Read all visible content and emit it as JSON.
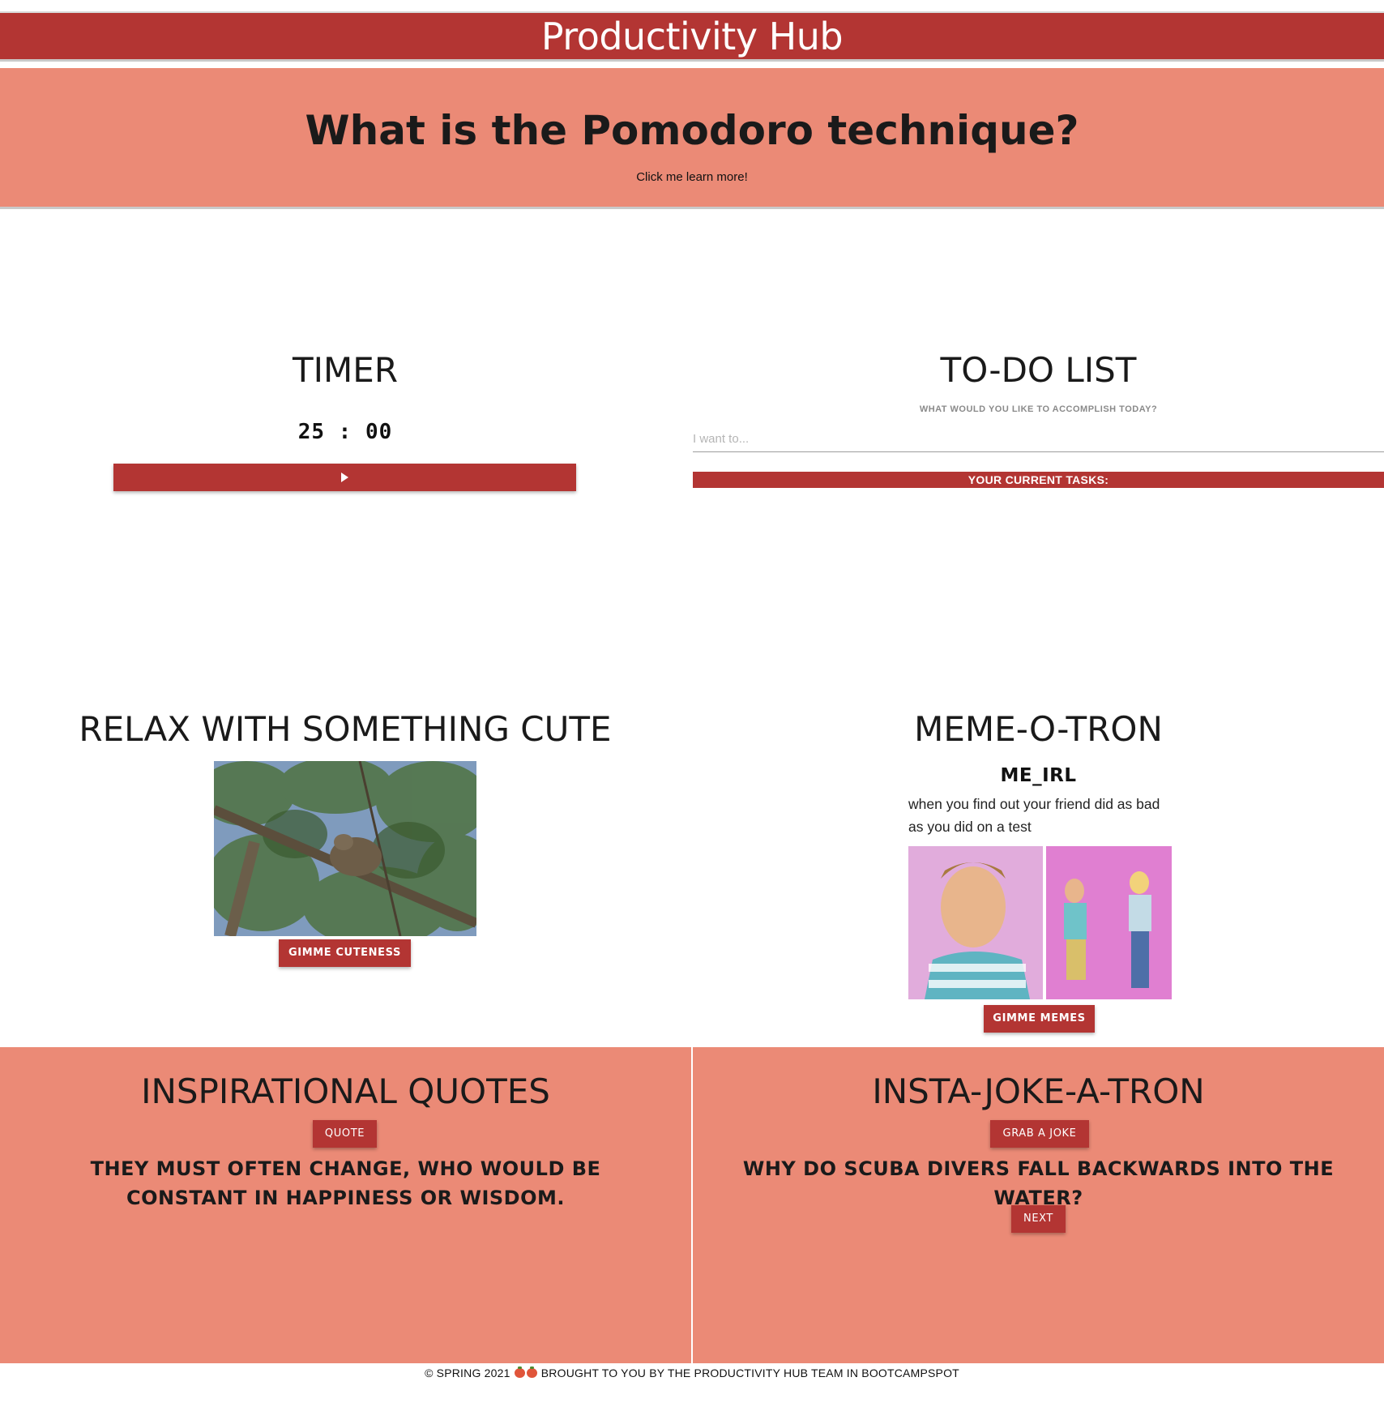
{
  "header": {
    "brand": "Productivity Hub"
  },
  "hero": {
    "title": "What is the Pomodoro technique?",
    "link": "Click me learn more!"
  },
  "timer": {
    "title": "TIMER",
    "display": "25 : 00",
    "play_icon": "play-icon"
  },
  "todo": {
    "title": "TO-DO LIST",
    "subtitle": "WHAT WOULD YOU LIKE TO ACCOMPLISH TODAY?",
    "placeholder": "I want to...",
    "value": "",
    "tasks_header": "YOUR CURRENT TASKS:"
  },
  "cute": {
    "title": "RELAX WITH SOMETHING CUTE",
    "image_subject": "sloth-in-tree",
    "button": "GIMME CUTENESS"
  },
  "meme": {
    "title": "MEME-O-TRON",
    "meme_title": "ME_IRL",
    "caption": "when you find out your friend did as bad as you did on a test",
    "button": "GIMME MEMES"
  },
  "quotes": {
    "title": "INSPIRATIONAL QUOTES",
    "button": "QUOTE",
    "text": "THEY MUST OFTEN CHANGE, WHO WOULD BE CONSTANT IN HAPPINESS OR WISDOM."
  },
  "jokes": {
    "title": "INSTA-JOKE-A-TRON",
    "button": "GRAB A JOKE",
    "text": "WHY DO SCUBA DIVERS FALL BACKWARDS INTO THE WATER?",
    "next": "NEXT"
  },
  "footer": {
    "left": "© SPRING 2021",
    "right": "BROUGHT TO YOU BY THE PRODUCTIVITY HUB TEAM IN BOOTCAMPSPOT",
    "icons": [
      "tomato-icon",
      "tomato-icon"
    ]
  },
  "colors": {
    "primary": "#b33533",
    "accent": "#eb8a76",
    "background": "#ffffff"
  }
}
